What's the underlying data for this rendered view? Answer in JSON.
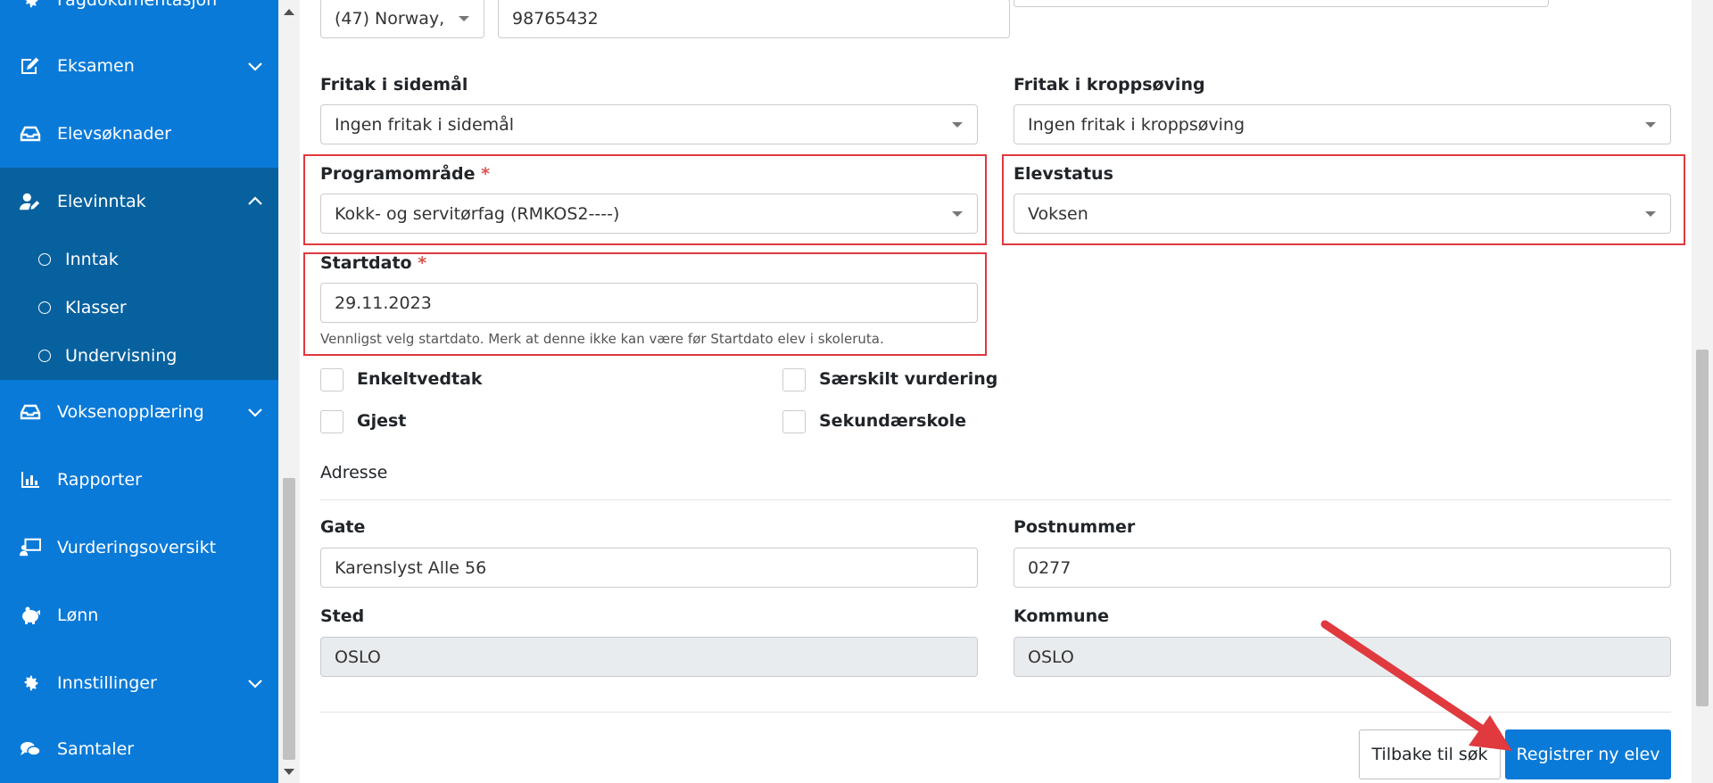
{
  "sidebar": {
    "top_partial_label": "Fagdokumentasjon",
    "items": [
      {
        "label": "Eksamen",
        "icon": "edit-icon",
        "expandable": true,
        "expanded": false
      },
      {
        "label": "Elevsøknader",
        "icon": "inbox-icon",
        "expandable": false
      },
      {
        "label": "Elevinntak",
        "icon": "user-edit-icon",
        "expandable": true,
        "expanded": true
      },
      {
        "label": "Voksenopplæring",
        "icon": "inbox-icon",
        "expandable": true,
        "expanded": false
      },
      {
        "label": "Rapporter",
        "icon": "bar-chart-icon",
        "expandable": false
      },
      {
        "label": "Vurderingsoversikt",
        "icon": "presentation-icon",
        "expandable": false
      },
      {
        "label": "Lønn",
        "icon": "piggy-bank-icon",
        "expandable": false
      },
      {
        "label": "Innstillinger",
        "icon": "gear-icon",
        "expandable": true,
        "expanded": false
      },
      {
        "label": "Samtaler",
        "icon": "chat-icon",
        "expandable": false
      }
    ],
    "subitems": [
      {
        "label": "Inntak"
      },
      {
        "label": "Klasser"
      },
      {
        "label": "Undervisning"
      }
    ],
    "colors": {
      "background": "#0a7ad8",
      "active": "#08619f"
    }
  },
  "form": {
    "phone": {
      "country_code": "(47) Norway,",
      "number": "98765432"
    },
    "fritak_sidemal": {
      "label": "Fritak i sidemål",
      "value": "Ingen fritak i sidemål"
    },
    "fritak_kroppsoving": {
      "label": "Fritak i kroppsøving",
      "value": "Ingen fritak i kroppsøving"
    },
    "programomrade": {
      "label": "Programområde",
      "required_mark": "*",
      "value": "Kokk- og servitørfag (RMKOS2----)"
    },
    "elevstatus": {
      "label": "Elevstatus",
      "value": "Voksen"
    },
    "startdato": {
      "label": "Startdato",
      "required_mark": "*",
      "value": "29.11.2023",
      "help": "Vennligst velg startdato. Merk at denne ikke kan være før Startdato elev i skoleruta."
    },
    "checkboxes": [
      {
        "label": "Enkeltvedtak",
        "checked": false
      },
      {
        "label": "Særskilt vurdering",
        "checked": false
      },
      {
        "label": "Gjest",
        "checked": false
      },
      {
        "label": "Sekundærskole",
        "checked": false
      }
    ],
    "adresse": {
      "section_title": "Adresse",
      "gate": {
        "label": "Gate",
        "value": "Karenslyst Alle 56"
      },
      "postnummer": {
        "label": "Postnummer",
        "value": "0277"
      },
      "sted": {
        "label": "Sted",
        "value": "OSLO"
      },
      "kommune": {
        "label": "Kommune",
        "value": "OSLO"
      }
    }
  },
  "actions": {
    "back_label": "Tilbake til søk",
    "register_label": "Registrer ny elev"
  },
  "annotation_colors": {
    "highlight": "#e0393e",
    "arrow": "#e0393e"
  }
}
